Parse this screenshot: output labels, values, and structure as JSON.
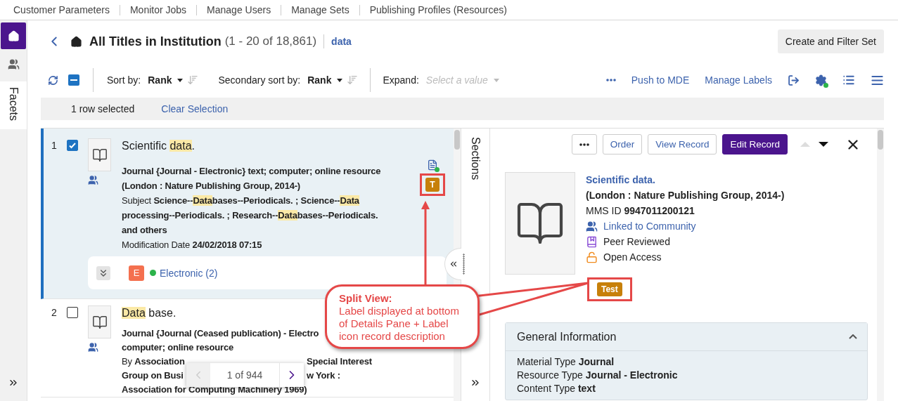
{
  "top_nav": [
    {
      "label": "Customer Parameters"
    },
    {
      "label": "Monitor Jobs"
    },
    {
      "label": "Manage Users"
    },
    {
      "label": "Manage Sets"
    },
    {
      "label": "Publishing Profiles (Resources)"
    }
  ],
  "rail": {
    "items": [
      {
        "kind": "home",
        "selected": true
      },
      {
        "kind": "community",
        "selected": false
      }
    ],
    "facets_label": "Facets"
  },
  "header": {
    "title": "All Titles in Institution",
    "count": "(1 - 20 of 18,861)",
    "query": "data",
    "action": "Create and Filter Set"
  },
  "toolbar": {
    "select_all_partial": true,
    "sorts": [
      {
        "label": "Sort by:",
        "value": "Rank"
      },
      {
        "label": "Secondary sort by:",
        "value": "Rank"
      }
    ],
    "expand": {
      "label": "Expand:",
      "placeholder": "Select a value"
    },
    "links": [
      "Push to MDE",
      "Manage Labels"
    ]
  },
  "selection": {
    "summary": "1 row selected",
    "clear": "Clear Selection"
  },
  "results": [
    {
      "number": "1",
      "selected": true,
      "checked": true,
      "note_icon": true,
      "title": [
        {
          "text": "Scientific "
        },
        {
          "text": "data",
          "highlight": true
        },
        {
          "text": "."
        }
      ],
      "lines": [
        [
          [
            {
              "text": "Journal {Journal - Electronic} text; computer; online resource (London : Nature Publishing Group, 2014-)"
            }
          ]
        ],
        [
          [
            {
              "text": "Subject ",
              "bold": false
            },
            {
              "text": "Science--"
            },
            {
              "text": "Data",
              "highlight": true
            },
            {
              "text": "bases--Periodicals. ; Science--"
            },
            {
              "text": "Data",
              "highlight": true
            },
            {
              "text": " processing--Periodicals. ; Research--"
            },
            {
              "text": "Data",
              "highlight": true
            },
            {
              "text": "bases--Periodicals."
            }
          ]
        ],
        [
          [
            {
              "text": "and others"
            }
          ]
        ],
        [
          [
            {
              "text": "Modification Date ",
              "bold": false
            },
            {
              "text": "24/02/2018 07:15"
            }
          ]
        ]
      ],
      "labels": [
        "T"
      ],
      "inventory": {
        "type": "E",
        "available": true,
        "link": "Electronic (2)"
      }
    },
    {
      "number": "2",
      "selected": false,
      "checked": false,
      "title": [
        {
          "text": "Data",
          "highlight": true
        },
        {
          "text": " base."
        }
      ],
      "lines": [
        [
          [
            {
              "text": "Journal {Journal (Ceased publication) - Electro"
            }
          ]
        ],
        [
          [
            {
              "text": "computer; online resource"
            }
          ]
        ],
        [
          [
            {
              "text": "By ",
              "bold": false
            },
            {
              "text": "Association"
            }
          ],
          [
            {
              "text": "Special Interest"
            }
          ]
        ],
        [
          [
            {
              "text": "Group on Busi"
            }
          ],
          [
            {
              "text": "w York :"
            }
          ]
        ],
        [
          [
            {
              "text": "Association for Computing Machinery 1969)"
            }
          ]
        ]
      ]
    }
  ],
  "pager": {
    "text": "1 of 944",
    "previous_disabled": true,
    "next_disabled": false
  },
  "sections_label": "Sections",
  "details": {
    "buttons": [
      {
        "label": "Order",
        "kind": "outline"
      },
      {
        "label": "View Record",
        "kind": "outline"
      },
      {
        "label": "Edit Record",
        "kind": "primary"
      }
    ],
    "previous_disabled": true,
    "next_disabled": false,
    "title": "Scientific data.",
    "imprint": "(London : Nature Publishing Group, 2014-)",
    "mms_label": "MMS ID",
    "mms_id": "9947011200121",
    "flags": [
      {
        "kind": "community",
        "text": "Linked to Community"
      },
      {
        "kind": "peer",
        "text": "Peer Reviewed"
      },
      {
        "kind": "open",
        "text": "Open Access"
      }
    ],
    "labels": [
      "Test"
    ],
    "section": {
      "title": "General Information",
      "expanded": true,
      "fields": [
        {
          "label": "Material Type",
          "value": "Journal"
        },
        {
          "label": "Resource Type",
          "value": "Journal - Electronic"
        },
        {
          "label": "Content Type",
          "value": "text"
        }
      ]
    }
  },
  "callout": {
    "text": "**Split View:** Label displayed at bottom of Details Pane + Label icon record description"
  }
}
